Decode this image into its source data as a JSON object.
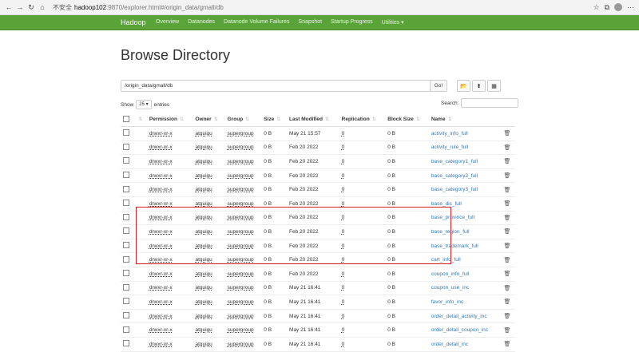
{
  "browser": {
    "security_label": "不安全",
    "url_host": "hadoop102",
    "url_path": ":9870/explorer.html#/origin_data/gmall/db"
  },
  "navbar": {
    "brand": "Hadoop",
    "links": [
      "Overview",
      "Datanodes",
      "Datanode Volume Failures",
      "Snapshot",
      "Startup Progress",
      "Utilities ▾"
    ]
  },
  "page": {
    "title": "Browse Directory",
    "path_value": "/origin_data/gmall/db",
    "go_label": "Go!",
    "show_label": "Show",
    "show_value": "25",
    "entries_label": "entries",
    "search_label": "Search:"
  },
  "table": {
    "headers": [
      "Permission",
      "Owner",
      "Group",
      "Size",
      "Last Modified",
      "Replication",
      "Block Size",
      "Name"
    ],
    "rows": [
      [
        "drwxr-xr-x",
        "atguigu",
        "supergroup",
        "0 B",
        "May 21 15:57",
        "0",
        "0 B",
        "activity_info_full"
      ],
      [
        "drwxr-xr-x",
        "atguigu",
        "supergroup",
        "0 B",
        "Feb 20 2022",
        "0",
        "0 B",
        "activity_rule_full"
      ],
      [
        "drwxr-xr-x",
        "atguigu",
        "supergroup",
        "0 B",
        "Feb 20 2022",
        "0",
        "0 B",
        "base_category1_full"
      ],
      [
        "drwxr-xr-x",
        "atguigu",
        "supergroup",
        "0 B",
        "Feb 20 2022",
        "0",
        "0 B",
        "base_category2_full"
      ],
      [
        "drwxr-xr-x",
        "atguigu",
        "supergroup",
        "0 B",
        "Feb 20 2022",
        "0",
        "0 B",
        "base_category3_full"
      ],
      [
        "drwxr-xr-x",
        "atguigu",
        "supergroup",
        "0 B",
        "Feb 20 2022",
        "0",
        "0 B",
        "base_dic_full"
      ],
      [
        "drwxr-xr-x",
        "atguigu",
        "supergroup",
        "0 B",
        "Feb 20 2022",
        "0",
        "0 B",
        "base_province_full"
      ],
      [
        "drwxr-xr-x",
        "atguigu",
        "supergroup",
        "0 B",
        "Feb 20 2022",
        "0",
        "0 B",
        "base_region_full"
      ],
      [
        "drwxr-xr-x",
        "atguigu",
        "supergroup",
        "0 B",
        "Feb 20 2022",
        "0",
        "0 B",
        "base_trademark_full"
      ],
      [
        "drwxr-xr-x",
        "atguigu",
        "supergroup",
        "0 B",
        "Feb 20 2022",
        "0",
        "0 B",
        "cart_info_full"
      ],
      [
        "drwxr-xr-x",
        "atguigu",
        "supergroup",
        "0 B",
        "Feb 20 2022",
        "0",
        "0 B",
        "coupon_info_full"
      ],
      [
        "drwxr-xr-x",
        "atguigu",
        "supergroup",
        "0 B",
        "May 21 16:41",
        "0",
        "0 B",
        "coupon_use_inc"
      ],
      [
        "drwxr-xr-x",
        "atguigu",
        "supergroup",
        "0 B",
        "May 21 16:41",
        "0",
        "0 B",
        "favor_info_inc"
      ],
      [
        "drwxr-xr-x",
        "atguigu",
        "supergroup",
        "0 B",
        "May 21 16:41",
        "0",
        "0 B",
        "order_detail_activity_inc"
      ],
      [
        "drwxr-xr-x",
        "atguigu",
        "supergroup",
        "0 B",
        "May 21 16:41",
        "0",
        "0 B",
        "order_detail_coupon_inc"
      ],
      [
        "drwxr-xr-x",
        "atguigu",
        "supergroup",
        "0 B",
        "May 21 16:41",
        "0",
        "0 B",
        "order_detail_inc"
      ]
    ]
  },
  "colors": {
    "navbar": "#5aa339",
    "link": "#337ab7",
    "highlight_box": "#d62020"
  },
  "icons": [
    "back-icon",
    "forward-icon",
    "reload-icon",
    "home-icon",
    "folder-open-icon",
    "upload-icon",
    "table-icon",
    "trash-icon"
  ]
}
